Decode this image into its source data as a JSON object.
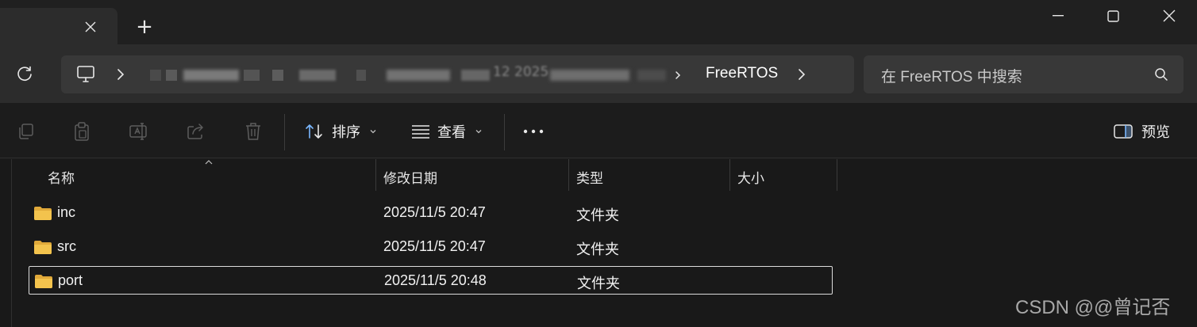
{
  "window": {
    "new_tab_label": "+"
  },
  "address": {
    "breadcrumb_partial": "12 2025",
    "current_folder": "FreeRTOS"
  },
  "search": {
    "placeholder": "在 FreeRTOS 中搜索"
  },
  "toolbar": {
    "sort_label": "排序",
    "view_label": "查看",
    "more_label": "•••",
    "preview_label": "预览"
  },
  "columns": {
    "name": "名称",
    "modified": "修改日期",
    "type": "类型",
    "size": "大小"
  },
  "files": [
    {
      "name": "inc",
      "modified": "2025/11/5 20:47",
      "type": "文件夹",
      "size": ""
    },
    {
      "name": "src",
      "modified": "2025/11/5 20:47",
      "type": "文件夹",
      "size": ""
    },
    {
      "name": "port",
      "modified": "2025/11/5 20:48",
      "type": "文件夹",
      "size": "",
      "selected": true
    }
  ],
  "icons": {
    "tab_close": "close-icon",
    "new_tab": "plus-icon",
    "refresh": "refresh-icon",
    "this_pc": "computer-icon",
    "search": "search-icon",
    "copy": "copy-icon",
    "paste": "paste-icon",
    "rename": "rename-icon",
    "share": "share-icon",
    "delete": "trash-icon",
    "sort": "sort-icon",
    "view": "view-list-icon",
    "preview": "preview-pane-icon",
    "folder": "folder-icon"
  },
  "watermark": "CSDN @@曾记否",
  "colors": {
    "background": "#191919",
    "folder": "#f3c34d",
    "accent": "#7ab8ff"
  }
}
